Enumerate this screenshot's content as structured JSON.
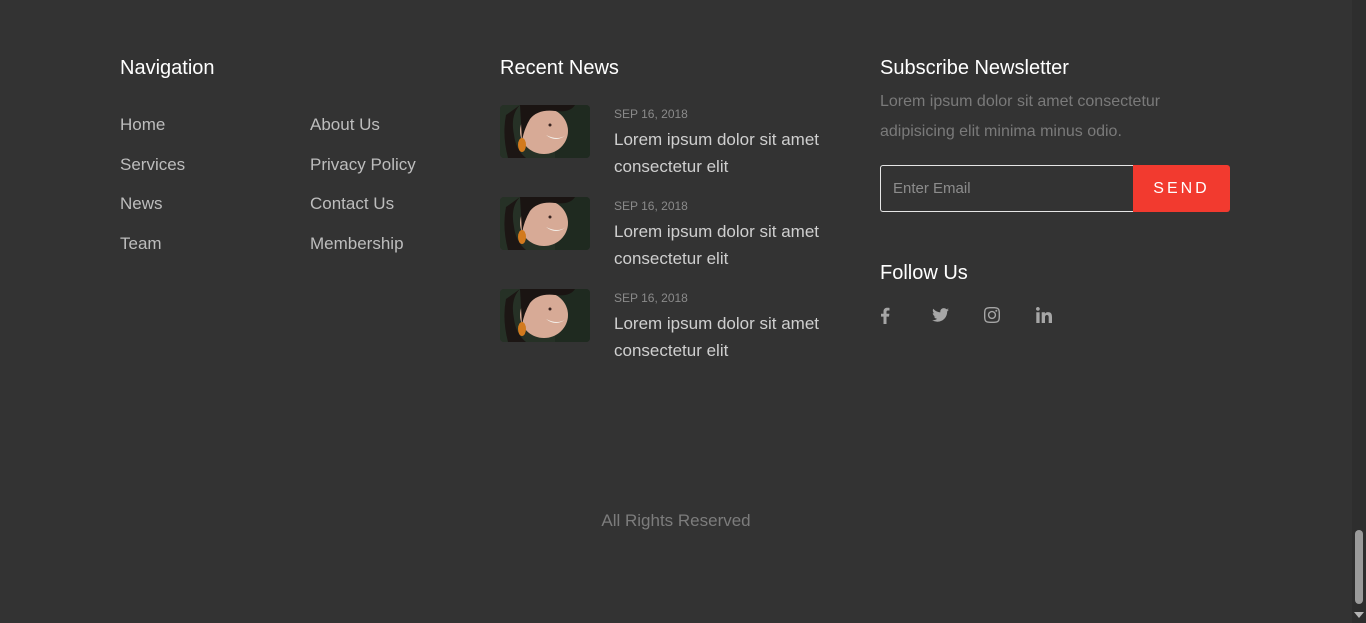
{
  "navigation": {
    "title": "Navigation",
    "links": [
      "Home",
      "About Us",
      "Services",
      "Privacy Policy",
      "News",
      "Contact Us",
      "Team",
      "Membership"
    ]
  },
  "recent_news": {
    "title": "Recent News",
    "items": [
      {
        "date": "SEP 16, 2018",
        "title": "Lorem ipsum dolor sit amet consectetur elit"
      },
      {
        "date": "SEP 16, 2018",
        "title": "Lorem ipsum dolor sit amet consectetur elit"
      },
      {
        "date": "SEP 16, 2018",
        "title": "Lorem ipsum dolor sit amet consectetur elit"
      }
    ]
  },
  "newsletter": {
    "title": "Subscribe Newsletter",
    "description": "Lorem ipsum dolor sit amet consectetur adipisicing elit minima minus odio.",
    "email_placeholder": "Enter Email",
    "send_label": "SEND"
  },
  "follow": {
    "title": "Follow Us",
    "icons": [
      "facebook-icon",
      "twitter-icon",
      "instagram-icon",
      "linkedin-icon"
    ]
  },
  "footer": {
    "copyright": "All Rights Reserved"
  },
  "colors": {
    "background": "#333333",
    "accent": "#f23a2f"
  }
}
